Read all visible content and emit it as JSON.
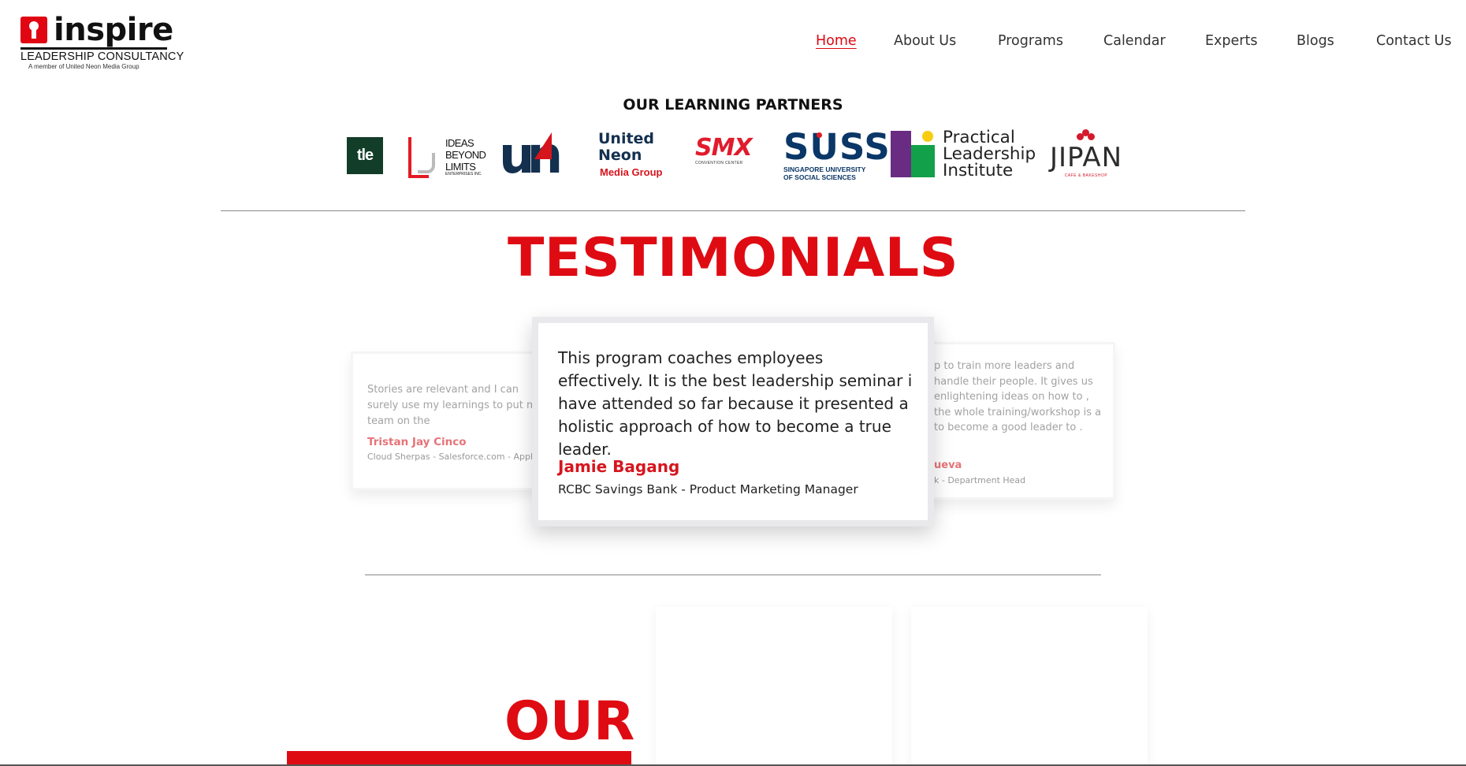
{
  "brand": {
    "name": "inspire",
    "subtitle": "LEADERSHIP CONSULTANCY",
    "tagline": "A member of United Neon Media Group",
    "accent_color": "#df0b13"
  },
  "nav": {
    "items": [
      {
        "label": "Home",
        "active": true
      },
      {
        "label": "About Us"
      },
      {
        "label": "Programs"
      },
      {
        "label": "Calendar"
      },
      {
        "label": "Experts"
      },
      {
        "label": "Blogs"
      },
      {
        "label": "Contact Us"
      }
    ]
  },
  "partners": {
    "title": "OUR LEARNING PARTNERS",
    "logos": {
      "tle": "tle",
      "ibl": "IDEAS\nBEYOND\nLIMITS",
      "ibl_small": "ENTERPRISES INC.",
      "un_mark": "un",
      "un_name": "United\nNeon",
      "un_group": "Media Group",
      "smx": "SMX",
      "smx_small": "CONVENTION CENTER",
      "suss": "SUSS",
      "suss_small": "SINGAPORE UNIVERSITY\nOF SOCIAL SCIENCES",
      "pli": "Practical\nLeadership\nInstitute",
      "jipan": "JIPAN",
      "jipan_small": "CAFE & BAKESHOP"
    }
  },
  "testimonials": {
    "title": "TESTIMONIALS",
    "left": {
      "quote": "Stories are relevant and I can surely use my learnings to put my team on the",
      "name": "Tristan Jay Cinco",
      "role": "Cloud Sherpas - Salesforce.com - Application"
    },
    "center": {
      "quote": "This program coaches employees effectively. It is the best leadership seminar i have attended so far because it presented a holistic approach of how to become a true leader.",
      "name": "Jamie Bagang",
      "role": "RCBC Savings Bank - Product Marketing Manager"
    },
    "right": {
      "quote": "p to train more leaders and handle their people. It gives us enlightening ideas on how to , the whole training/workshop is a to become a good leader to .",
      "name": "ueva",
      "role": "k - Department Head"
    }
  },
  "section_our": {
    "heading": "OUR"
  }
}
